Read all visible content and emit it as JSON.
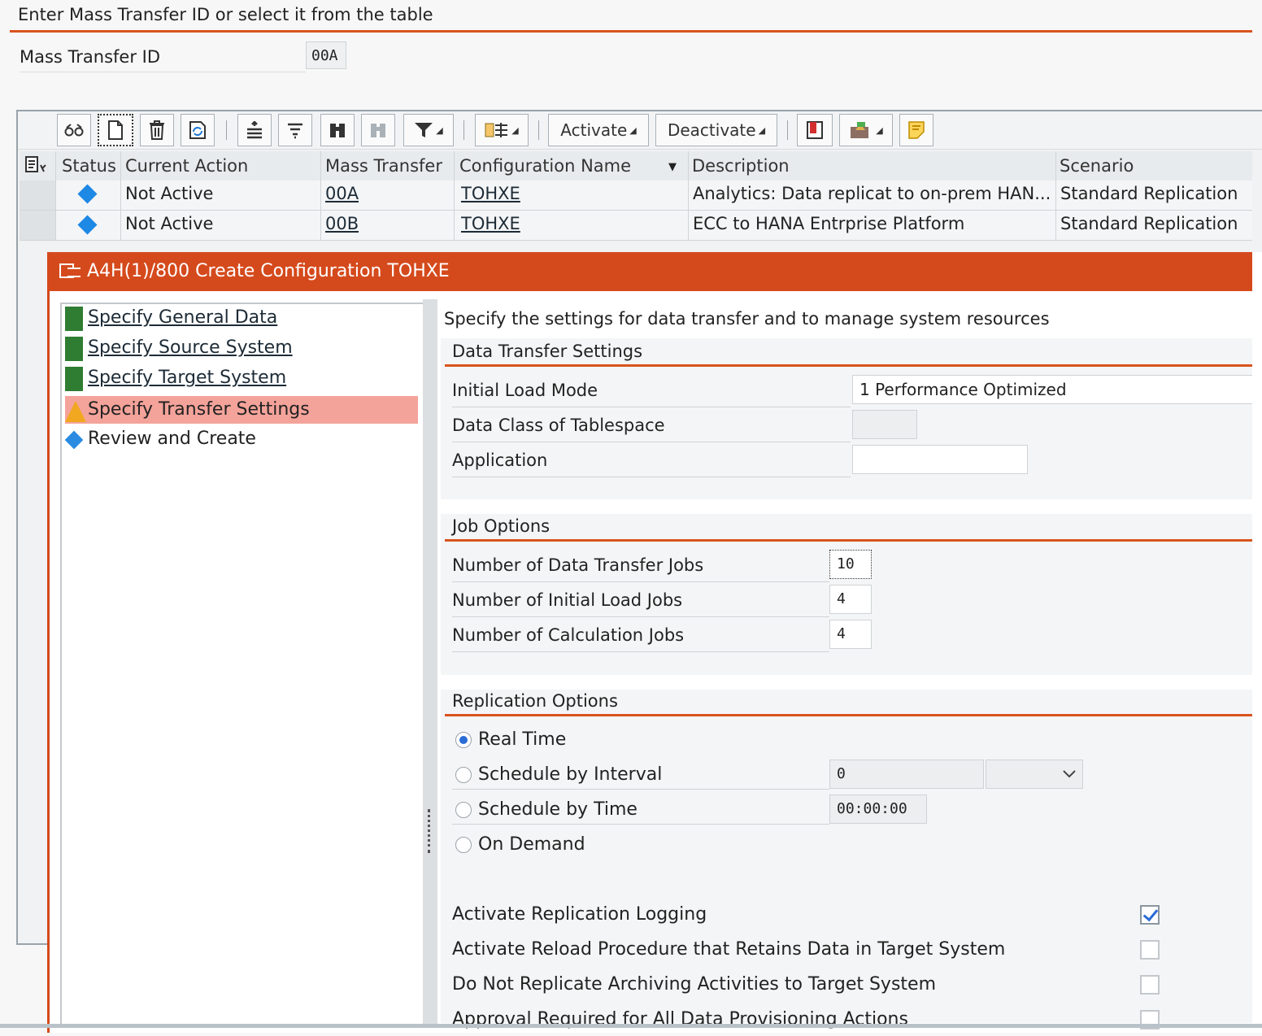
{
  "header": {
    "hint": "Enter Mass Transfer ID or select it from the table",
    "mass_transfer_label": "Mass Transfer ID",
    "mass_transfer_value": "00A"
  },
  "toolbar": {
    "activate_label": "Activate",
    "deactivate_label": "Deactivate"
  },
  "table": {
    "columns": [
      "Status",
      "Current Action",
      "Mass Transfer",
      "Configuration Name",
      "Description",
      "Scenario"
    ],
    "rows": [
      {
        "current_action": "Not Active",
        "mass_transfer": "00A",
        "configuration_name": "TOHXE",
        "description": "Analytics: Data replicat to on-prem HAN...",
        "scenario": "Standard Replication"
      },
      {
        "current_action": "Not Active",
        "mass_transfer": "00B",
        "configuration_name": "TOHXE",
        "description": "ECC to HANA Entrprise Platform",
        "scenario": "Standard Replication"
      }
    ]
  },
  "dialog": {
    "title": "A4H(1)/800 Create Configuration TOHXE",
    "steps": [
      {
        "label": "Specify General Data",
        "state": "done"
      },
      {
        "label": "Specify Source System",
        "state": "done"
      },
      {
        "label": "Specify Target System",
        "state": "done"
      },
      {
        "label": "Specify Transfer Settings",
        "state": "current"
      },
      {
        "label": "Review and Create",
        "state": "pending"
      }
    ],
    "intro": "Specify the settings for data transfer and to manage system resources",
    "data_transfer": {
      "title": "Data Transfer Settings",
      "initial_load_mode_label": "Initial Load Mode",
      "initial_load_mode_value": "1 Performance Optimized",
      "data_class_label": "Data Class of Tablespace",
      "data_class_value": "",
      "application_label": "Application",
      "application_value": ""
    },
    "job_options": {
      "title": "Job Options",
      "data_transfer_jobs_label": "Number of Data Transfer Jobs",
      "data_transfer_jobs_value": "10",
      "initial_load_jobs_label": "Number of Initial Load Jobs",
      "initial_load_jobs_value": "4",
      "calculation_jobs_label": "Number of Calculation Jobs",
      "calculation_jobs_value": "4"
    },
    "replication": {
      "title": "Replication Options",
      "real_time": "Real Time",
      "schedule_interval": "Schedule by Interval",
      "interval_value": "0",
      "interval_unit": "",
      "schedule_time": "Schedule by Time",
      "time_value": "00:00:00",
      "on_demand": "On Demand",
      "selected": "Real Time"
    },
    "flags": [
      {
        "label": "Activate Replication Logging",
        "checked": true
      },
      {
        "label": "Activate Reload Procedure that Retains Data in Target System",
        "checked": false
      },
      {
        "label": "Do Not Replicate Archiving Activities to Target System",
        "checked": false
      },
      {
        "label": "Approval Required for All Data Provisioning Actions",
        "checked": false
      }
    ]
  },
  "colors": {
    "accent": "#d54a1c",
    "status_blue": "#1e88e5",
    "step_done": "#2e7d32",
    "step_current": "#f4a39a",
    "warning": "#f1a820"
  }
}
